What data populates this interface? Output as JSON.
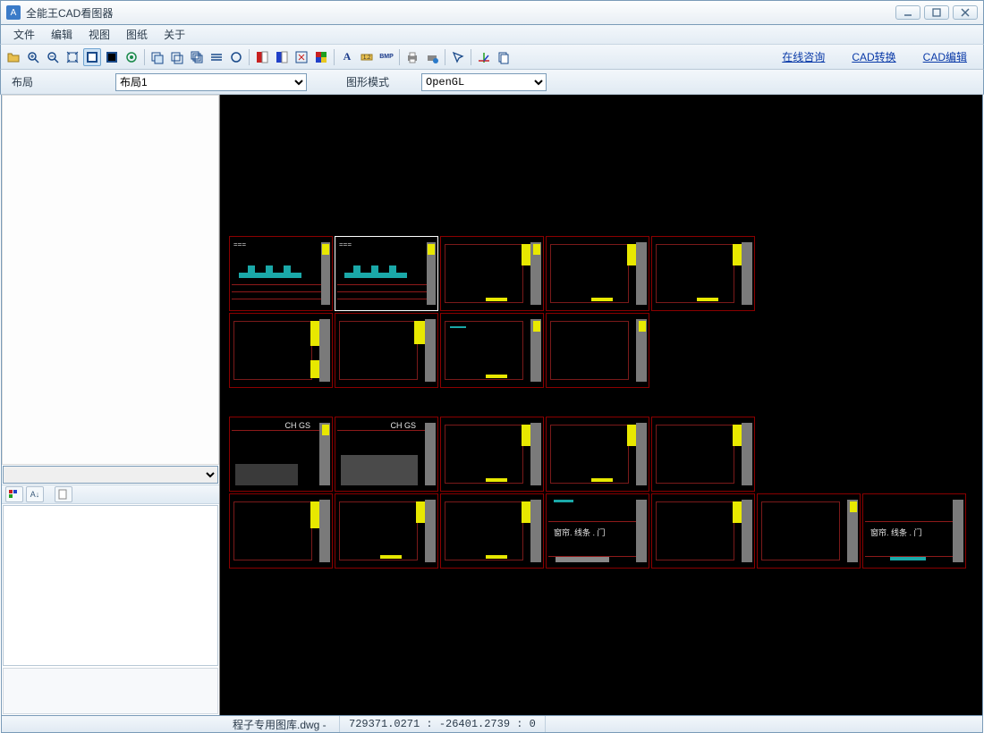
{
  "window": {
    "title": "全能王CAD看图器"
  },
  "menu": {
    "file": "文件",
    "edit": "编辑",
    "view": "视图",
    "drawing": "图纸",
    "about": "关于"
  },
  "toolbar_links": {
    "consult": "在线咨询",
    "convert": "CAD转换",
    "editcad": "CAD编辑"
  },
  "subbar": {
    "layout_label": "布局",
    "layout_value": "布局1",
    "mode_label": "图形模式",
    "mode_value": "OpenGL"
  },
  "thumb_labels": {
    "chgs": "CH GS",
    "curtain": "窗帘. 线条 . 门"
  },
  "status": {
    "filename": "程子专用图库.dwg -",
    "coords": "729371.0271 : -26401.2739 : 0"
  },
  "icons": {
    "open": "open",
    "zoomin": "zoom-in",
    "zoomout": "zoom-out",
    "zoomext": "zoom-extents",
    "pan": "pan",
    "orbit": "orbit",
    "region": "region",
    "layers": "layers",
    "mlin": "multiline",
    "grid": "grid",
    "fill": "fill",
    "col1": "color-red",
    "col2": "color-blue",
    "winx": "window-x",
    "text": "text-tool",
    "dim": "dimension",
    "bmp": "bmp-export",
    "print": "print",
    "save": "save",
    "arrow": "arrow",
    "axis": "axis",
    "copy": "copy"
  }
}
